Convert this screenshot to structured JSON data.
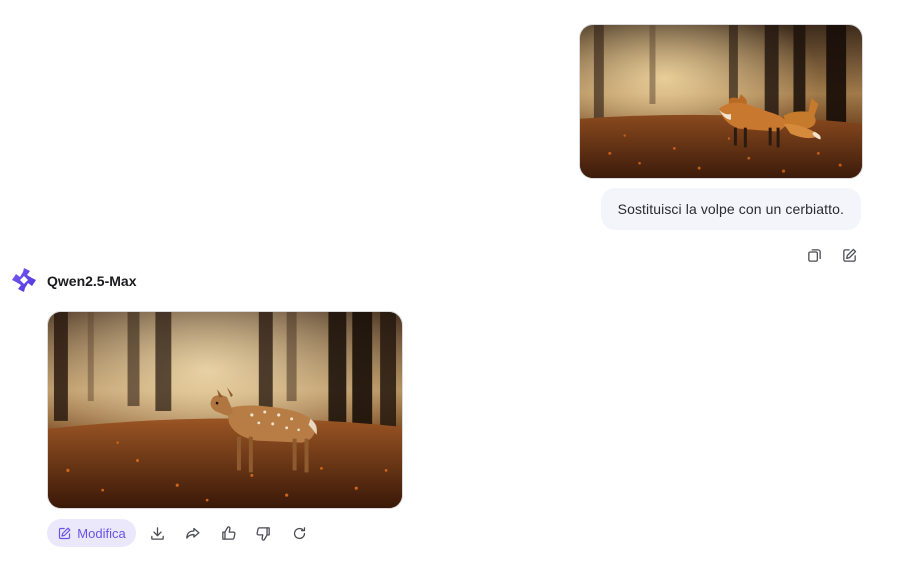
{
  "conversation": {
    "user_message": {
      "text": "Sostituisci la volpe con un cerbiatto.",
      "image_subject": "fox in autumn forest"
    },
    "assistant": {
      "model_name": "Qwen2.5-Max",
      "image_subject": "fawn in autumn forest",
      "edit_label": "Modifica"
    }
  },
  "icons": {
    "user_actions": [
      "copy-icon",
      "edit-icon"
    ],
    "assistant_actions": [
      "edit-icon",
      "download-icon",
      "share-icon",
      "thumbs-up-icon",
      "thumbs-down-icon",
      "regenerate-icon"
    ]
  },
  "colors": {
    "accent": "#6a52e6",
    "accent_bg": "#ece8fc",
    "bubble_bg": "#f4f5fb"
  }
}
